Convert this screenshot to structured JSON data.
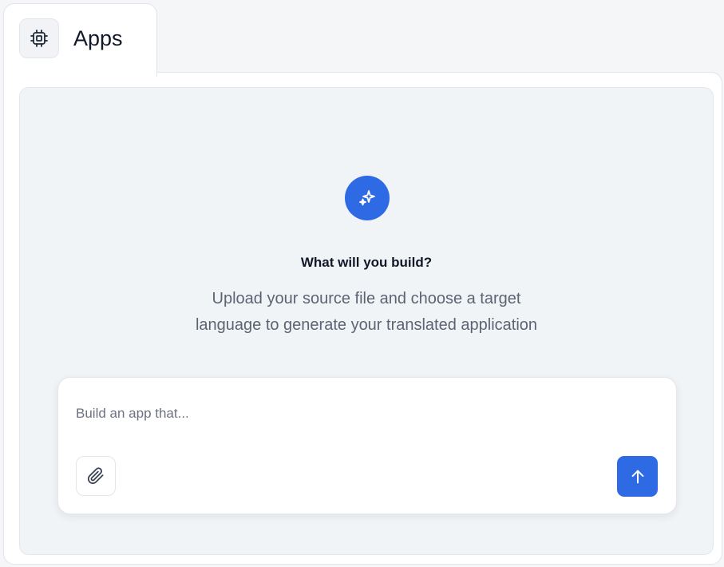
{
  "tab": {
    "label": "Apps",
    "icon": "cpu-chip-icon"
  },
  "hero": {
    "icon": "sparkles-icon",
    "title": "What will you build?",
    "subtitle_line1": "Upload your source file and choose a target",
    "subtitle_line2": "language to generate your translated application"
  },
  "composer": {
    "placeholder": "Build an app that...",
    "value": "",
    "attach_icon": "paperclip-icon",
    "send_icon": "arrow-up-icon"
  },
  "colors": {
    "accent": "#2d6ae3",
    "panel_bg": "#f1f4f7",
    "page_bg": "#f5f6f8"
  }
}
